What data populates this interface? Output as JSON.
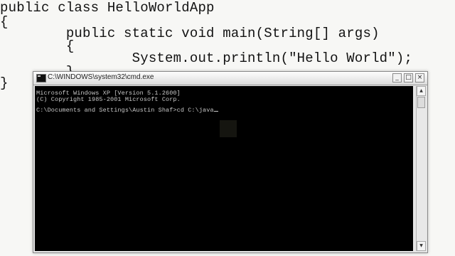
{
  "editor": {
    "lines": [
      "public class HelloWorldApp",
      "{",
      "        public static void main(String[] args)",
      "        {",
      "                System.out.println(\"Hello World\");",
      "        }",
      "}"
    ]
  },
  "cmd": {
    "title": "C:\\WINDOWS\\system32\\cmd.exe",
    "buttons": {
      "minimize": "_",
      "maximize": "□",
      "close": "×"
    },
    "lines": [
      "Microsoft Windows XP [Version 5.1.2600]",
      "(C) Copyright 1985-2001 Microsoft Corp.",
      "",
      "C:\\Documents and Settings\\Austin Shaf>cd C:\\java"
    ]
  },
  "icons": {
    "window_icon": "cmd-window-icon",
    "scroll_up": "scroll-up-arrow-icon",
    "scroll_down": "scroll-down-arrow-icon"
  }
}
